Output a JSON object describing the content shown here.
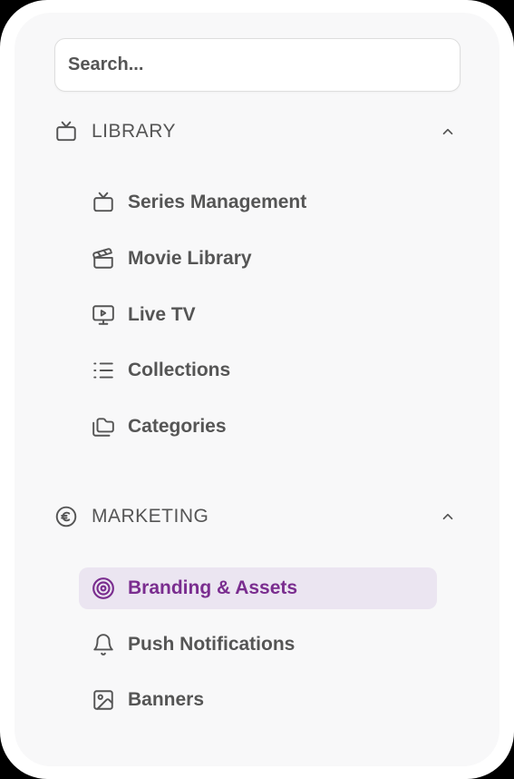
{
  "search": {
    "placeholder": "Search..."
  },
  "sections": {
    "library": {
      "label": "LIBRARY",
      "icon": "tv-icon",
      "expanded": true,
      "items": [
        {
          "label": "Series Management",
          "icon": "tv-icon"
        },
        {
          "label": "Movie Library",
          "icon": "clapperboard-icon"
        },
        {
          "label": "Live TV",
          "icon": "monitor-play-icon"
        },
        {
          "label": "Collections",
          "icon": "list-icon"
        },
        {
          "label": "Categories",
          "icon": "folders-icon"
        }
      ]
    },
    "marketing": {
      "label": "MARKETING",
      "icon": "euro-circle-icon",
      "expanded": true,
      "items": [
        {
          "label": "Branding & Assets",
          "icon": "target-icon",
          "active": true
        },
        {
          "label": "Push Notifications",
          "icon": "bell-icon"
        },
        {
          "label": "Banners",
          "icon": "image-icon"
        }
      ]
    }
  },
  "colors": {
    "text": "#555555",
    "accent": "#7a2d8f",
    "active_bg": "#ebe5f1",
    "panel_bg": "#f8f8f9"
  }
}
